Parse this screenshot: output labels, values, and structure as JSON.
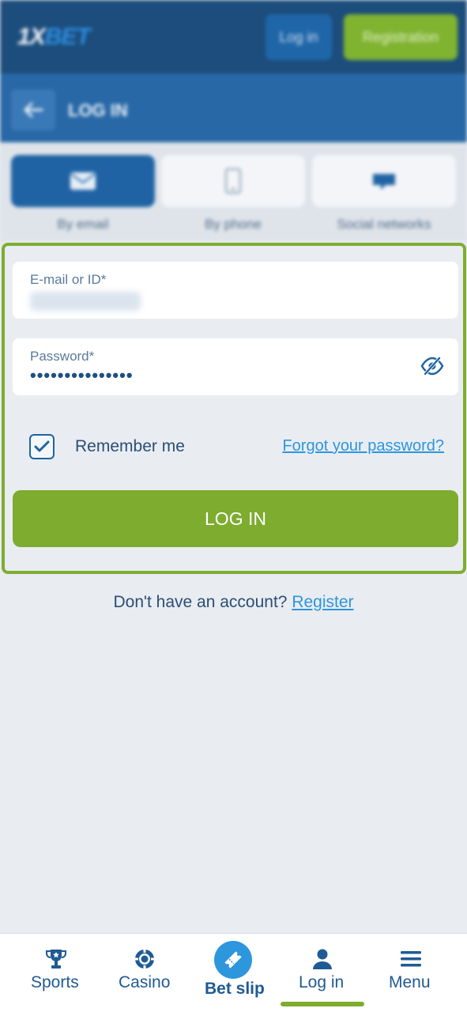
{
  "header": {
    "logo_prefix": "1X",
    "logo_suffix": "BET",
    "login_label": "Log in",
    "register_label": "Registration"
  },
  "subheader": {
    "title": "LOG IN"
  },
  "methods": [
    {
      "label": "By email",
      "icon": "envelope-icon",
      "active": true
    },
    {
      "label": "By phone",
      "icon": "phone-icon",
      "active": false
    },
    {
      "label": "Social networks",
      "icon": "social-icon",
      "active": false
    }
  ],
  "form": {
    "email_label": "E-mail or ID*",
    "password_label": "Password*",
    "password_mask": "•••••••••••••••",
    "remember_label": "Remember me",
    "remember_checked": true,
    "forgot_label": "Forgot your password?",
    "submit_label": "LOG IN"
  },
  "signup": {
    "prompt": "Don't have an account?",
    "link": "Register"
  },
  "bottom_nav": {
    "items": [
      {
        "label": "Sports",
        "icon": "trophy-icon"
      },
      {
        "label": "Casino",
        "icon": "chip-icon"
      },
      {
        "label": "Bet slip",
        "icon": "ticket-icon"
      },
      {
        "label": "Log in",
        "icon": "user-icon",
        "active": true
      },
      {
        "label": "Menu",
        "icon": "menu-icon"
      }
    ]
  },
  "colors": {
    "brand_dark": "#1c4d7c",
    "brand_blue": "#1f63a4",
    "accent_green": "#7dac2f",
    "link_blue": "#2d96dd",
    "text_dark": "#2a4e75"
  }
}
